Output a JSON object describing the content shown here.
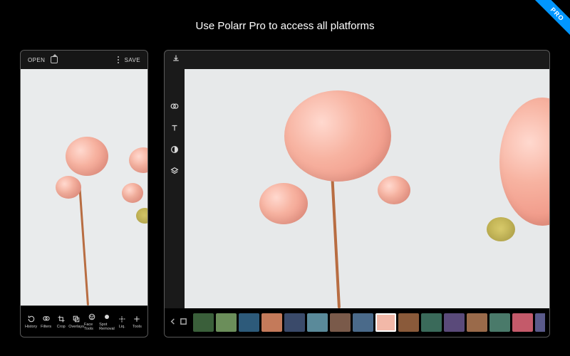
{
  "ribbon": "PRO",
  "headline": "Use Polarr Pro to access all platforms",
  "phone": {
    "open_label": "OPEN",
    "save_label": "SAVE",
    "toolbar": [
      {
        "id": "history",
        "label": "History"
      },
      {
        "id": "filters",
        "label": "Filters"
      },
      {
        "id": "crop",
        "label": "Crop"
      },
      {
        "id": "overlays",
        "label": "Overlays"
      },
      {
        "id": "face-tools",
        "label": "Face Tools"
      },
      {
        "id": "spot-removal",
        "label": "Spot Removal"
      },
      {
        "id": "liq",
        "label": "Liq."
      },
      {
        "id": "tools",
        "label": "Tools"
      }
    ]
  },
  "desktop": {
    "side_tools": [
      {
        "id": "filters"
      },
      {
        "id": "text"
      },
      {
        "id": "color"
      },
      {
        "id": "layers"
      }
    ],
    "thumbnails": [
      {
        "color": "#3a5f3a"
      },
      {
        "color": "#6b8e5a"
      },
      {
        "color": "#2d5a7a"
      },
      {
        "color": "#c47a5a"
      },
      {
        "color": "#3a4a6a"
      },
      {
        "color": "#5a8a9a"
      },
      {
        "color": "#7a5a4a"
      },
      {
        "color": "#4a6a8a"
      },
      {
        "color": "#f2b8a8",
        "selected": true
      },
      {
        "color": "#8a5a3a"
      },
      {
        "color": "#3a6a5a"
      },
      {
        "color": "#5a4a7a"
      },
      {
        "color": "#9a6a4a"
      },
      {
        "color": "#4a7a6a"
      },
      {
        "color": "#c45a6a"
      },
      {
        "color": "#5a5a8a"
      }
    ]
  }
}
